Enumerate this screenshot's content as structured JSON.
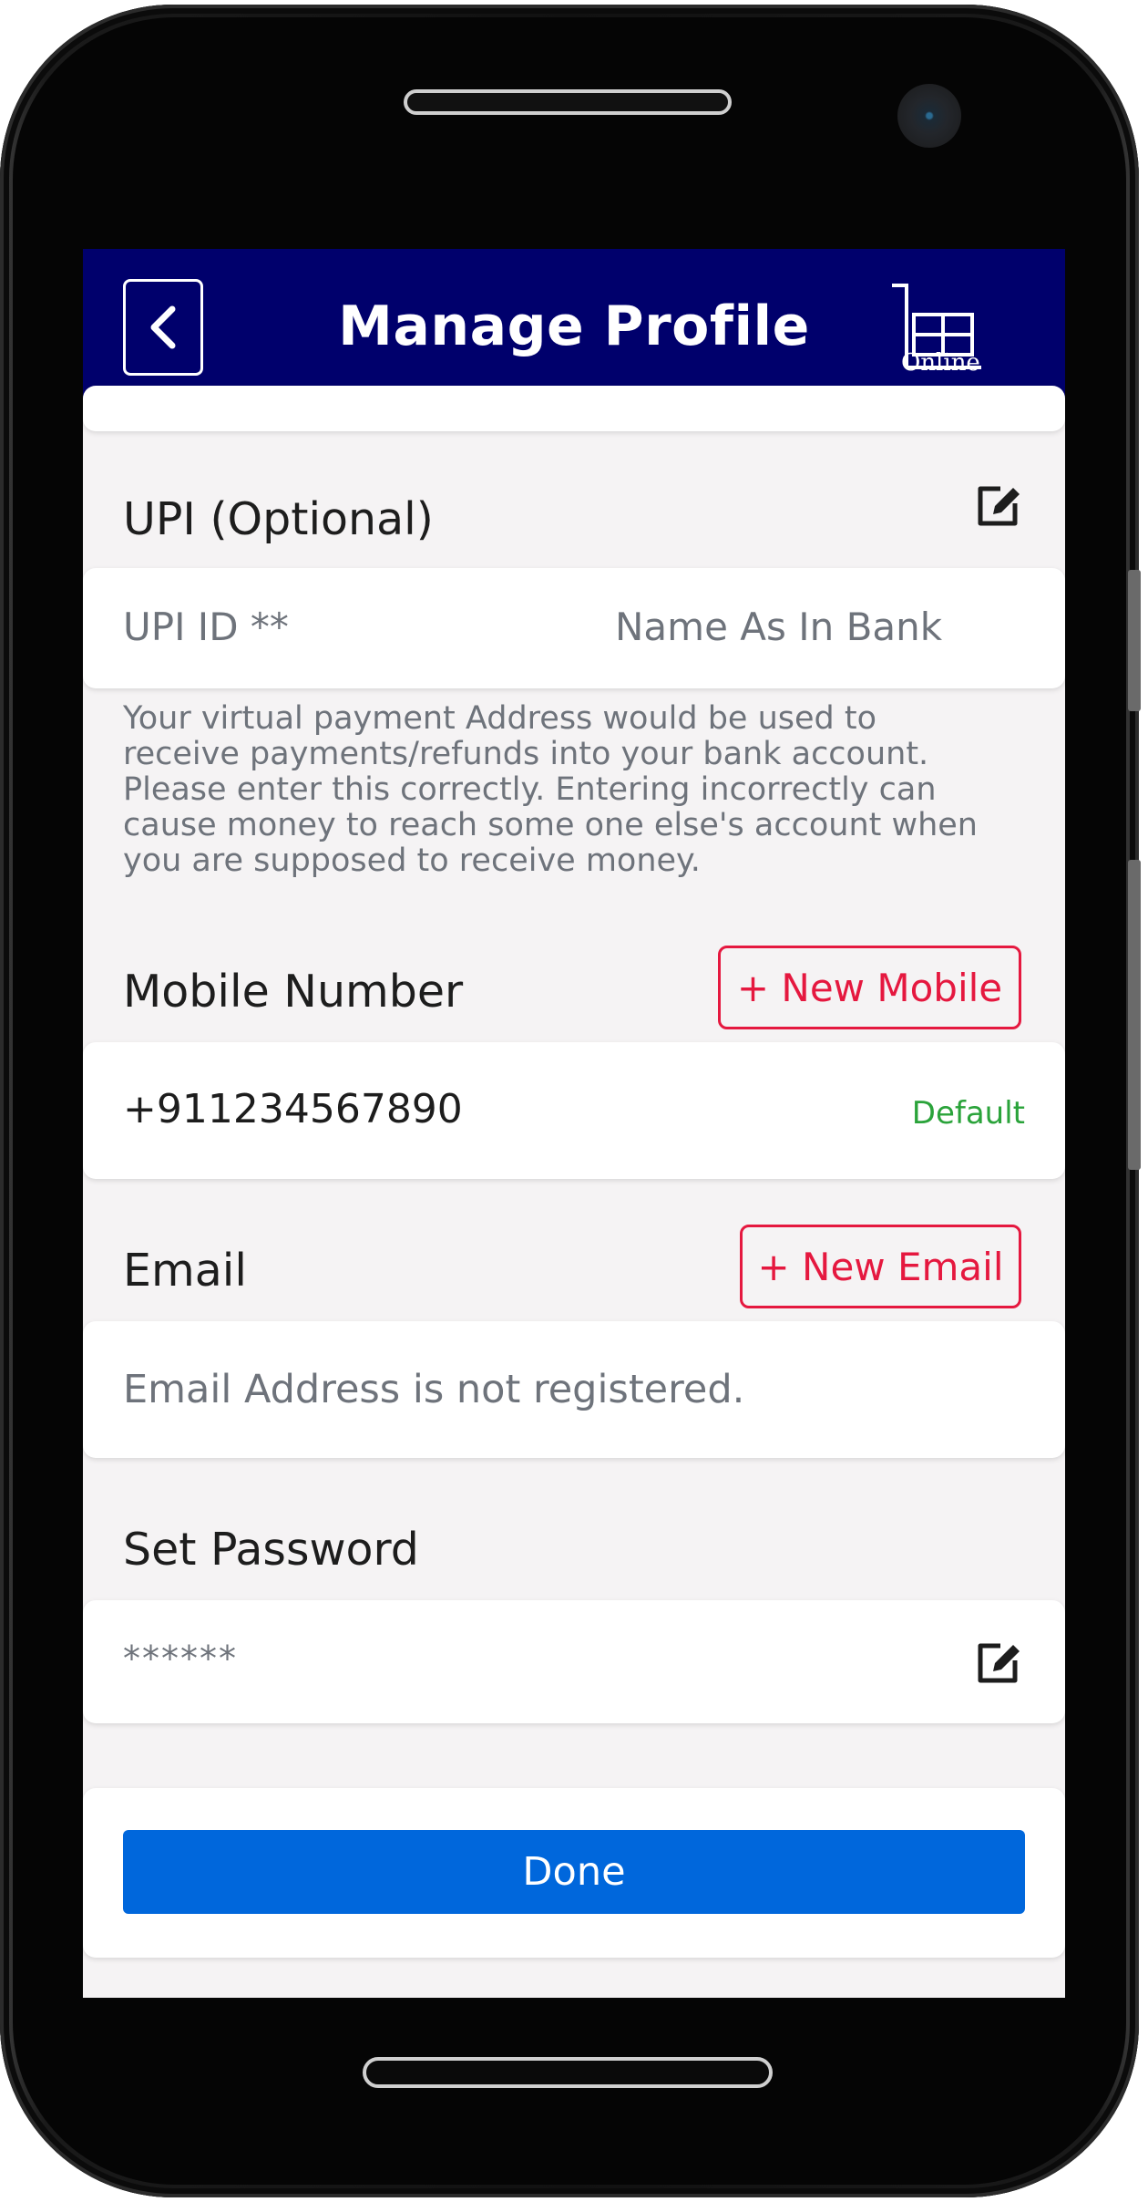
{
  "header": {
    "title": "Manage Profile",
    "logo_text": "Online"
  },
  "upi": {
    "title": "UPI (Optional)",
    "id_placeholder": "UPI ID **",
    "name_placeholder": "Name As In Bank",
    "note_lines": [
      "Your virtual payment Address would be used to",
      "receive payments/refunds into your bank account.",
      "Please enter this correctly. Entering incorrectly can",
      "cause money to reach some one else's account when",
      "you are supposed to receive money."
    ]
  },
  "mobile": {
    "title": "Mobile Number",
    "add_label": "+ New Mobile",
    "number": "+911234567890",
    "badge": "Default"
  },
  "email": {
    "title": "Email",
    "add_label": "+ New Email",
    "empty_text": "Email Address is not registered."
  },
  "password": {
    "title": "Set Password",
    "value": "******"
  },
  "actions": {
    "done_label": "Done"
  },
  "colors": {
    "header_bg": "#00006c",
    "accent_red": "#e5183f",
    "primary_blue": "#0067dc",
    "default_green": "#2aa33a"
  }
}
